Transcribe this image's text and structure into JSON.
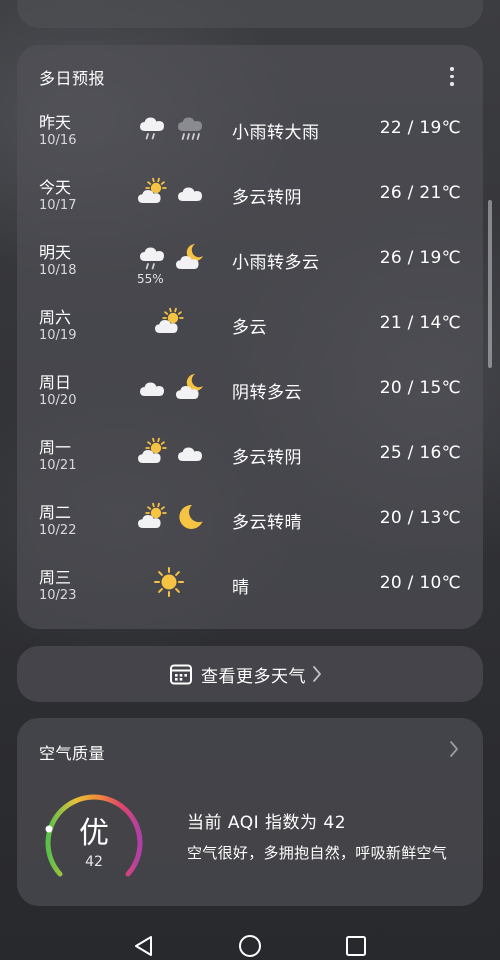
{
  "forecast": {
    "title": "多日预报",
    "days": [
      {
        "name": "昨天",
        "date": "10/16",
        "icon_day": "light-rain-icon",
        "icon_night": "heavy-rain-icon",
        "precip": "",
        "desc": "小雨转大雨",
        "temp": "22 / 19℃"
      },
      {
        "name": "今天",
        "date": "10/17",
        "icon_day": "partly-cloudy-icon",
        "icon_night": "cloud-icon",
        "precip": "",
        "desc": "多云转阴",
        "temp": "26 / 21℃"
      },
      {
        "name": "明天",
        "date": "10/18",
        "icon_day": "light-rain-icon",
        "icon_night": "cloudy-night-icon",
        "precip": "55%",
        "desc": "小雨转多云",
        "temp": "26 / 19℃"
      },
      {
        "name": "周六",
        "date": "10/19",
        "icon_day": "partly-cloudy-icon",
        "icon_night": "",
        "precip": "",
        "desc": "多云",
        "temp": "21 / 14℃"
      },
      {
        "name": "周日",
        "date": "10/20",
        "icon_day": "cloud-icon",
        "icon_night": "cloudy-night-icon",
        "precip": "",
        "desc": "阴转多云",
        "temp": "20 / 15℃"
      },
      {
        "name": "周一",
        "date": "10/21",
        "icon_day": "partly-cloudy-icon",
        "icon_night": "cloud-icon",
        "precip": "",
        "desc": "多云转阴",
        "temp": "25 / 16℃"
      },
      {
        "name": "周二",
        "date": "10/22",
        "icon_day": "partly-cloudy-icon",
        "icon_night": "moon-icon",
        "precip": "",
        "desc": "多云转晴",
        "temp": "20 / 13℃"
      },
      {
        "name": "周三",
        "date": "10/23",
        "icon_day": "sun-icon",
        "icon_night": "",
        "precip": "",
        "desc": "晴",
        "temp": "20 / 10℃"
      }
    ]
  },
  "more_weather": {
    "label": "查看更多天气",
    "icon": "calendar-icon"
  },
  "air_quality": {
    "title": "空气质量",
    "level": "优",
    "aqi": "42",
    "headline": "当前 AQI 指数为 42",
    "description": "空气很好，多拥抱自然，呼吸新鲜空气"
  },
  "nav": {
    "back_icon": "back-triangle-icon",
    "home_icon": "home-circle-icon",
    "recents_icon": "recents-square-icon"
  },
  "colors": {
    "sun": "#f6c343",
    "cloud": "#f2f2f4",
    "rain_cloud": "#8a8b90",
    "rain_drop": "#cfd0d4",
    "gauge_good": "#58c04a",
    "gauge_mid": "#f0b33a",
    "gauge_bad": "#d0409a"
  }
}
